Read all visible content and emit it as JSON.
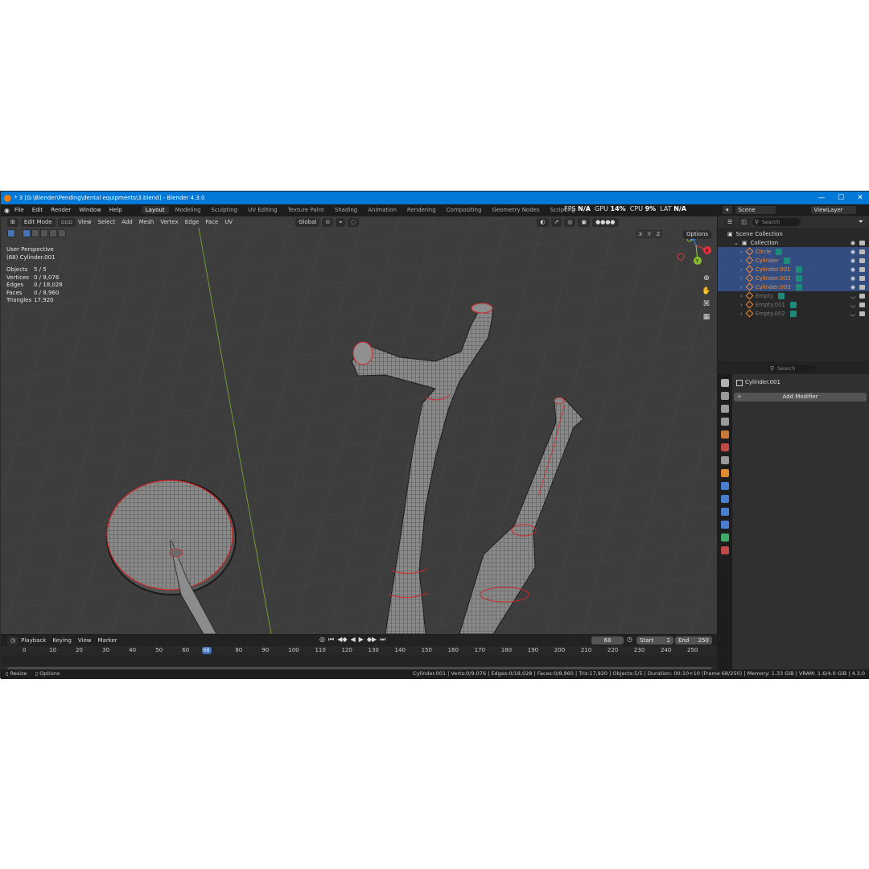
{
  "window": {
    "title": "* 3 [G:\\Blender\\Pending\\dental equipments\\3.blend] - Blender 4.3.0",
    "controls": [
      "—",
      "☐",
      "✕"
    ]
  },
  "menu": [
    "File",
    "Edit",
    "Render",
    "Window",
    "Help"
  ],
  "workspaces": {
    "tabs": [
      "Layout",
      "Modeling",
      "Sculpting",
      "UV Editing",
      "Texture Paint",
      "Shading",
      "Animation",
      "Rendering",
      "Compositing",
      "Geometry Nodes",
      "Scripting"
    ],
    "active": "Layout",
    "add": "+"
  },
  "stats": {
    "fps_label": "FPS",
    "fps_value": "N/A",
    "gpu_label": "GPU",
    "gpu_value": "14%",
    "cpu_label": "CPU",
    "cpu_value": "9%",
    "lat_label": "LAT",
    "lat_value": "N/A"
  },
  "viewport_header": {
    "mode": "Edit Mode",
    "menus": [
      "View",
      "Select",
      "Add",
      "Mesh",
      "Vertex",
      "Edge",
      "Face",
      "UV"
    ],
    "transform_orientation": "Global",
    "options": "Options",
    "axes": [
      "X",
      "Y",
      "Z"
    ]
  },
  "overlay": {
    "view_name": "User Perspective",
    "object_line": "(68) Cylinder.001",
    "rows": [
      {
        "label": "Objects",
        "value": "5 / 5"
      },
      {
        "label": "Vertices",
        "value": "0 / 9,076"
      },
      {
        "label": "Edges",
        "value": "0 / 18,028"
      },
      {
        "label": "Faces",
        "value": "0 / 8,960"
      },
      {
        "label": "Triangles",
        "value": "17,920"
      }
    ]
  },
  "gizmo": {
    "x": "X",
    "y": "Y",
    "z": "Z",
    "colors": {
      "x": "#e2323f",
      "y": "#8bbc2f",
      "z": "#2f7fde"
    }
  },
  "timeline": {
    "menus": [
      "Playback",
      "Keying",
      "View",
      "Marker"
    ],
    "current_frame": "68",
    "start_label": "Start",
    "start": "1",
    "end_label": "End",
    "end": "250",
    "ticks": [
      "0",
      "10",
      "20",
      "30",
      "40",
      "50",
      "60",
      "80",
      "90",
      "100",
      "110",
      "120",
      "130",
      "140",
      "150",
      "160",
      "170",
      "180",
      "190",
      "200",
      "210",
      "220",
      "230",
      "240",
      "250"
    ],
    "current_frame_value": 68,
    "frame_range": [
      0,
      250
    ]
  },
  "statusbar": {
    "left": [
      "Resize",
      "Options"
    ],
    "right": "Cylinder.001 | Verts:0/9,076 | Edges:0/18,028 | Faces:0/8,960 | Tris:17,920 | Objects:5/5 | Duration: 00:10+10 (Frame 68/250) | Memory: 1.33 GiB | VRAM: 1.6/4.0 GiB | 4.3.0"
  },
  "outliner": {
    "scene_label": "Scene",
    "viewlayer_label": "ViewLayer",
    "search_placeholder": "Search",
    "scene_collection": "Scene Collection",
    "collection": "Collection",
    "objects": [
      {
        "name": "Circle",
        "selected": true,
        "visible": true
      },
      {
        "name": "Cylinder",
        "selected": true,
        "visible": true
      },
      {
        "name": "Cylinder.001",
        "selected": true,
        "visible": true
      },
      {
        "name": "Cylinder.002",
        "selected": true,
        "visible": true
      },
      {
        "name": "Cylinder.003",
        "selected": true,
        "visible": true
      },
      {
        "name": "Empty",
        "selected": false,
        "visible": false
      },
      {
        "name": "Empty.001",
        "selected": false,
        "visible": false
      },
      {
        "name": "Empty.002",
        "selected": false,
        "visible": false
      }
    ]
  },
  "properties": {
    "search_placeholder": "Search",
    "object_name": "Cylinder.001",
    "add_modifier": "Add Modifier"
  },
  "colors": {
    "selection": "#334d80",
    "accent": "#4772b3",
    "object": "#f08a32",
    "modifier": "#1e8a7a"
  }
}
